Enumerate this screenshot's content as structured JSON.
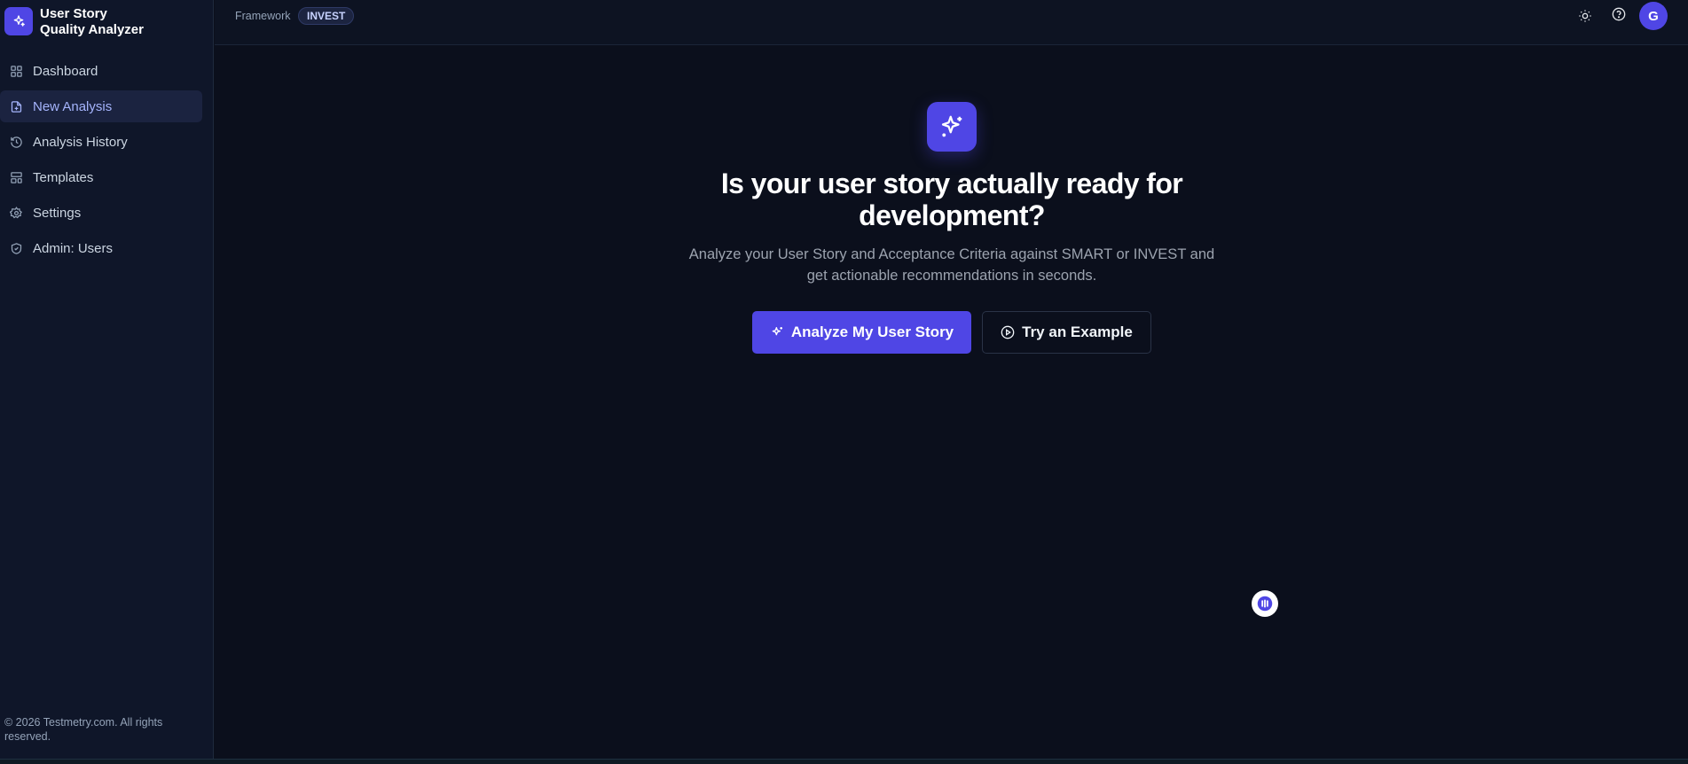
{
  "brand": {
    "line1": "User Story",
    "line2": "Quality Analyzer",
    "accent": "#4f46e5"
  },
  "sidebar": {
    "items": [
      {
        "label": "Dashboard",
        "icon": "grid-icon"
      },
      {
        "label": "New Analysis",
        "icon": "file-plus-icon",
        "active": true
      },
      {
        "label": "Analysis History",
        "icon": "history-icon"
      },
      {
        "label": "Templates",
        "icon": "layout-icon"
      },
      {
        "label": "Settings",
        "icon": "gear-icon"
      },
      {
        "label": "Admin: Users",
        "icon": "shield-icon"
      }
    ],
    "footer": "© 2026 Testmetry.com. All rights reserved."
  },
  "topbar": {
    "framework_label": "Framework",
    "framework_value": "INVEST",
    "theme_icon": "sun-icon",
    "help_icon": "help-circle-icon",
    "avatar_initial": "G"
  },
  "hero": {
    "icon": "sparkles-icon",
    "title": "Is your user story actually ready for development?",
    "subtitle": "Analyze your User Story and Acceptance Criteria against SMART or INVEST and get actionable recommendations in seconds.",
    "primary_button": "Analyze My User Story",
    "secondary_button": "Try an Example"
  }
}
